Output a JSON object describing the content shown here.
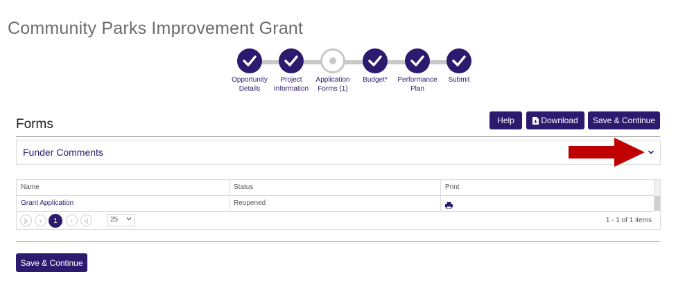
{
  "page": {
    "title": "Community Parks Improvement Grant"
  },
  "stepper": {
    "steps": [
      {
        "label": "Opportunity Details",
        "line1": "Opportunity",
        "line2": "Details",
        "state": "complete"
      },
      {
        "label": "Project Information",
        "line1": "Project",
        "line2": "Information",
        "state": "complete"
      },
      {
        "label": "Application Forms (1)",
        "line1": "Application",
        "line2": "Forms (1)",
        "state": "current"
      },
      {
        "label": "Budget*",
        "line1": "Budget*",
        "line2": "",
        "state": "complete"
      },
      {
        "label": "Performance Plan",
        "line1": "Performance",
        "line2": "Plan",
        "state": "complete"
      },
      {
        "label": "Submit",
        "line1": "Submit",
        "line2": "",
        "state": "complete"
      }
    ]
  },
  "section": {
    "title": "Forms"
  },
  "toolbar": {
    "help_label": "Help",
    "download_label": "Download",
    "save_continue_label": "Save & Continue"
  },
  "panel": {
    "title": "Funder Comments",
    "expand_icon": "chevron-down-icon"
  },
  "grid": {
    "columns": [
      "Name",
      "Status",
      "Print"
    ],
    "rows": [
      {
        "name": "Grant Application",
        "status": "Reopened",
        "print_icon": "printer-icon"
      }
    ]
  },
  "pager": {
    "current_page": "1",
    "page_size": "25",
    "info": "1 - 1 of 1 items"
  },
  "footer": {
    "save_continue_label": "Save & Continue"
  },
  "colors": {
    "brand": "#2c1a6e",
    "annotation_arrow": "#c00000",
    "step_pending": "#c8c8c8"
  }
}
